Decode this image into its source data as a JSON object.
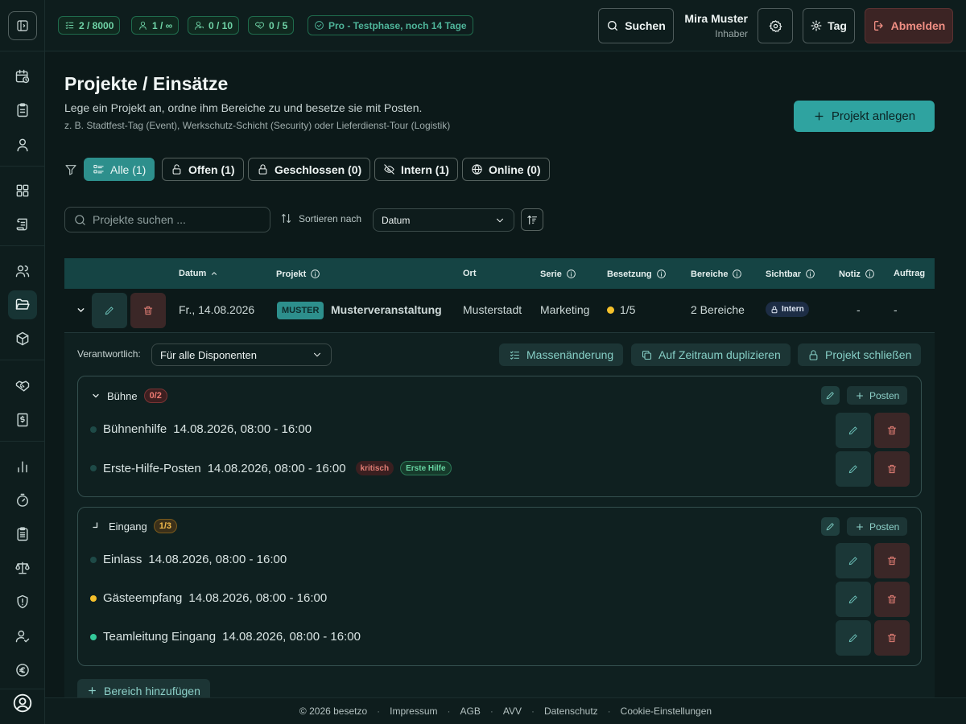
{
  "topbar": {
    "stats": [
      {
        "icon": "checklist-icon",
        "value": "2 / 8000"
      },
      {
        "icon": "user-icon",
        "value": "1 / ∞"
      },
      {
        "icon": "user-key-icon",
        "value": "0 / 10"
      },
      {
        "icon": "handshake-icon",
        "value": "0 / 5"
      }
    ],
    "trial": "Pro - Testphase, noch 14 Tage",
    "search_label": "Suchen",
    "user_name": "Mira Muster",
    "user_role": "Inhaber",
    "theme_label": "Tag",
    "logout_label": "Abmelden"
  },
  "page": {
    "title": "Projekte / Einsätze",
    "subtitle": "Lege ein Projekt an, ordne ihm Bereiche zu und besetze sie mit Posten.",
    "hint": "z. B. Stadtfest-Tag (Event), Werkschutz-Schicht (Security) oder Lieferdienst-Tour (Logistik)",
    "create_label": "Projekt anlegen"
  },
  "filters": [
    {
      "label": "Alle (1)",
      "icon": "list-icon",
      "active": true
    },
    {
      "label": "Offen (1)",
      "icon": "unlock-icon",
      "active": false
    },
    {
      "label": "Geschlossen (0)",
      "icon": "lock-icon",
      "active": false
    },
    {
      "label": "Intern (1)",
      "icon": "eye-off-icon",
      "active": false
    },
    {
      "label": "Online (0)",
      "icon": "globe-icon",
      "active": false
    }
  ],
  "search": {
    "placeholder": "Projekte suchen ..."
  },
  "sort": {
    "label": "Sortieren nach",
    "value": "Datum"
  },
  "table": {
    "headers": {
      "datum": "Datum",
      "projekt": "Projekt",
      "ort": "Ort",
      "serie": "Serie",
      "besetzung": "Besetzung",
      "bereiche": "Bereiche",
      "sichtbar": "Sichtbar",
      "notiz": "Notiz",
      "auftrag": "Auftrag"
    },
    "row": {
      "datum": "Fr., 14.08.2026",
      "badge": "MUSTER",
      "projekt": "Musterveranstaltung",
      "ort": "Musterstadt",
      "serie": "Marketing",
      "besetzung": "1/5",
      "besetzung_color": "#f5c02b",
      "bereiche": "2 Bereiche",
      "sichtbar": "Intern",
      "notiz": "-",
      "auftrag": "-"
    }
  },
  "details": {
    "responsible_label": "Verantwortlich:",
    "responsible_value": "Für alle Disponenten",
    "actions": [
      "Massenänderung",
      "Auf Zeitraum duplizieren",
      "Projekt schließen"
    ],
    "posten_label": "Posten",
    "add_area_label": "Bereich hinzufügen",
    "sections": [
      {
        "name": "Bühne",
        "count": "0/2",
        "items": [
          {
            "name": "Bühnenhilfe",
            "time": "14.08.2026, 08:00 - 16:00",
            "dot": "#1e4a47"
          },
          {
            "name": "Erste-Hilfe-Posten",
            "time": "14.08.2026, 08:00 - 16:00",
            "dot": "#1e4a47",
            "tags": [
              "kritisch",
              "Erste Hilfe"
            ]
          }
        ]
      },
      {
        "name": "Eingang",
        "count": "1/3",
        "items": [
          {
            "name": "Einlass",
            "time": "14.08.2026, 08:00 - 16:00",
            "dot": "#1e4a47"
          },
          {
            "name": "Gästeempfang",
            "time": "14.08.2026, 08:00 - 16:00",
            "dot": "#f5c02b"
          },
          {
            "name": "Teamleitung Eingang",
            "time": "14.08.2026, 08:00 - 16:00",
            "dot": "#34c99a"
          }
        ]
      }
    ]
  },
  "footer": [
    "© 2026 besetzo",
    "Impressum",
    "AGB",
    "AVV",
    "Datenschutz",
    "Cookie-Einstellungen"
  ],
  "colors": {
    "accent": "#2fa3a0",
    "background": "#0c1919",
    "danger": "#e47f76"
  }
}
